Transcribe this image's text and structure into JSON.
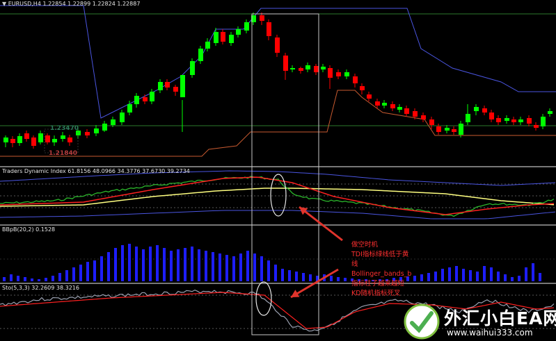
{
  "main": {
    "label": "EURUSD,H4  1.22854 1.22899 1.22824 1.22887",
    "price_tag_1": "1.23470",
    "price_tag_2": "1.21840"
  },
  "tdi": {
    "label": "Traders Dynamic Index 61.8156 48.0966 34.3776 37.6730 39.2734"
  },
  "bbpb": {
    "label": "BBpB(20,2) 0.1528"
  },
  "sto": {
    "label": "Sto(5,3,3) 32.2609 38.3216"
  },
  "annotation": {
    "line1": "做空时机",
    "line2": "TDI指标绿线低于黄",
    "line3": "线",
    "line4": "Bollinger_bands_b",
    "line5": "指标柱子越来越短",
    "line6": "KD随机指标死叉"
  },
  "watermark": {
    "cn": "外汇小白EA网",
    "url": "www.waihui333.com"
  },
  "colors": {
    "bull": "#00ff00",
    "bear": "#ff0000",
    "channel": "#4a55e0",
    "lower": "#c85a30",
    "annot": "#ff3030"
  }
}
